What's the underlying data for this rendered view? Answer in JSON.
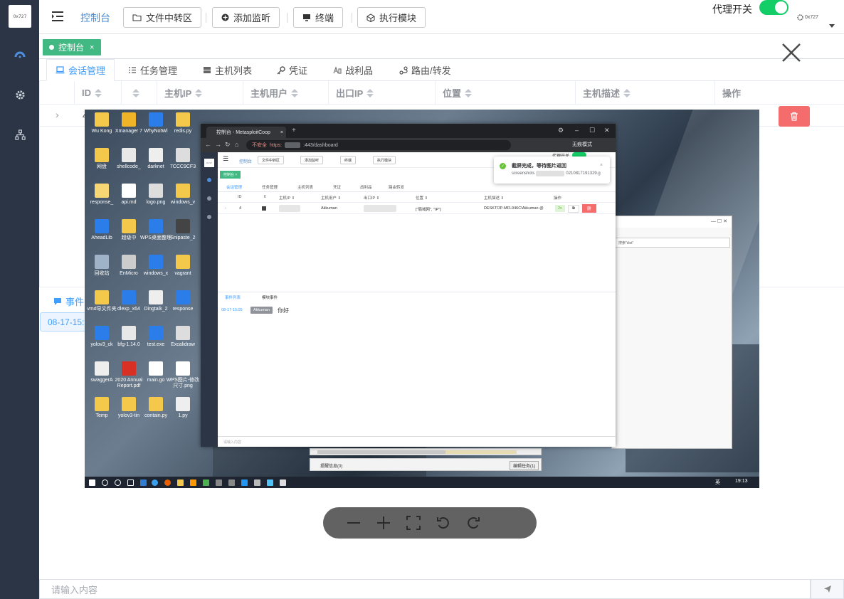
{
  "app": {
    "logo_text": "0x727"
  },
  "header": {
    "breadcrumb": "控制台",
    "buttons": [
      "文件中转区",
      "添加监听",
      "终端",
      "执行模块"
    ],
    "proxy_label": "代理开关",
    "proxy_on": true,
    "user": "0x727"
  },
  "tagbar": {
    "tag_label": "控制台",
    "tag_close": "×"
  },
  "tabs": [
    {
      "label": "会话管理",
      "icon": "laptop-icon",
      "active": true
    },
    {
      "label": "任务管理",
      "icon": "task-list-icon"
    },
    {
      "label": "主机列表",
      "icon": "server-icon"
    },
    {
      "label": "凭证",
      "icon": "key-icon"
    },
    {
      "label": "战利品",
      "icon": "loot-icon"
    },
    {
      "label": "路由/转发",
      "icon": "route-icon"
    }
  ],
  "table": {
    "columns": [
      "ID",
      "",
      "主机IP",
      "主机用户",
      "出口IP",
      "位置",
      "主机描述",
      "操作"
    ],
    "row": {
      "expand": "›",
      "id_partial": "4"
    }
  },
  "lower": {
    "tab_partial": "事件",
    "log_time_partial": "08-17-15:"
  },
  "input": {
    "placeholder": "请输入内容"
  },
  "viewer": {
    "close": "✕",
    "desktop_icons": [
      "Wu Kong",
      "网盘",
      "response_",
      "AheadLib",
      "回收站",
      "vmd导文件夹",
      "yolov3_ck",
      "swaggerA",
      "Temp",
      "Xmanager 7",
      "shellcode_",
      "api.md",
      "超级中",
      "EnMicro",
      "dlexp_x64",
      "bfg-1.14.0",
      "2020 Annual Report.pdf",
      "yolov3-tin",
      "WhyNotWi",
      "darknet",
      "logo.png",
      "WPS桌面整理",
      "windows_x",
      "Dingtalk_2",
      "test.exe",
      "main.go",
      "contain.py",
      "redis.py",
      "7CCC9CF3",
      "windows_v",
      "Snipaste_2",
      "vagrant",
      "response",
      "Excalidraw",
      "WPS图片-修改尺寸.png",
      "1.py"
    ],
    "taskbar": {
      "lang": "英",
      "time": "19:13"
    },
    "inner_browser": {
      "tab_title": "控制台 - MetasploitCoop",
      "url_warn": "不安全",
      "url_scheme": "https:",
      "url_path": ":443/dashboard",
      "incognito": "无痕模式",
      "breadcrumb": "控制台",
      "buttons": [
        "文件中转区",
        "添加监听",
        "终端",
        "执行模块"
      ],
      "proxy": "代理开关",
      "tag": "控制台 ×",
      "tabs": [
        "会话管理",
        "任务管理",
        "主机列表",
        "凭证",
        "战利品",
        "路由转发"
      ],
      "columns": [
        "ID",
        "⇕",
        "主机IP ⇕",
        "主机用户 ⇕",
        "出口IP ⇕",
        "位置 ⇕",
        "主机描述 ⇕",
        "操作"
      ],
      "row": {
        "id": "4",
        "user": "Akkuman",
        "location": "[\"局域网\", \"IP\"]",
        "desc": "DESKTOP-MFL946C\\Akkuman @",
        "btn_a": "2x",
        "btn_del": "删"
      },
      "lower_tabs": [
        "事件列表",
        "模块事件"
      ],
      "log_time": "08-17-15:05",
      "log_user": "Akkuman",
      "log_msg": "你好",
      "input_placeholder": "请输入内容"
    },
    "notification": {
      "title": "截屏完成，等待图片返回",
      "body_prefix": "screenshots",
      "body_suffix": "0210817191329.g",
      "close": "×"
    },
    "explorer": {
      "search": "搜索\"dist\""
    },
    "statusbar": {
      "left": "提醒信息(0)",
      "right": "编辑任务(1)"
    }
  },
  "viewer_toolbar": [
    "zoom-out-icon",
    "zoom-in-icon",
    "fullscreen-icon",
    "rotate-left-icon",
    "rotate-right-icon"
  ],
  "colors": {
    "sidebar": "#2b3545",
    "accent": "#409eff",
    "tag": "#42b983",
    "switch_on": "#13ce66",
    "danger": "#f56c6c"
  }
}
